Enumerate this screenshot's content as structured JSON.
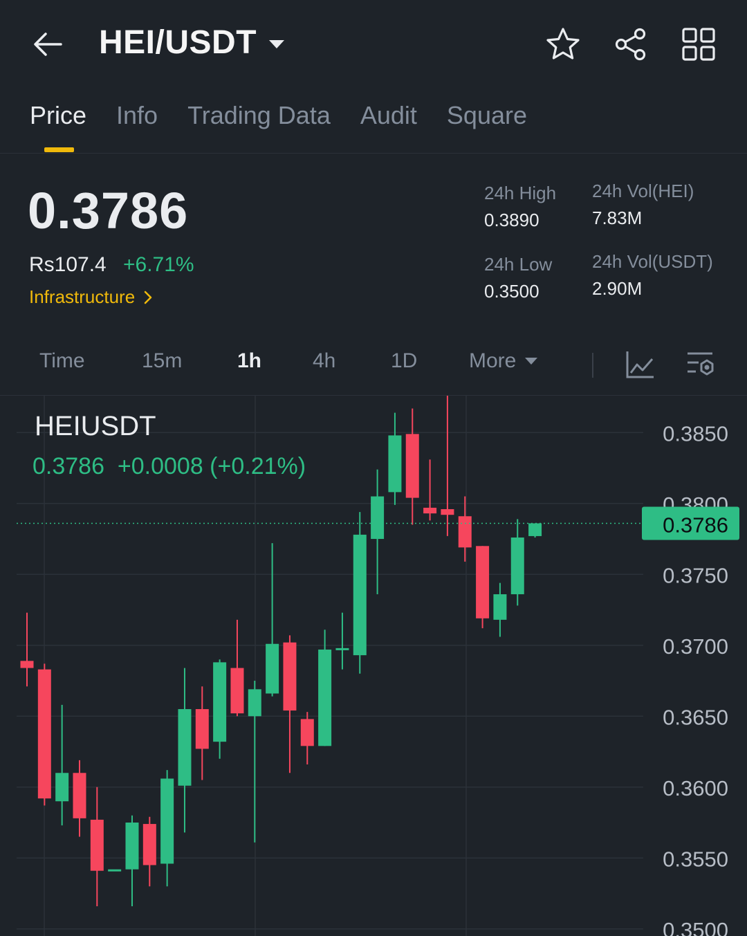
{
  "header": {
    "pair": "HEI/USDT",
    "icons": [
      "back-arrow-icon",
      "caret-down-icon",
      "star-icon",
      "share-icon",
      "grid-icon"
    ]
  },
  "tabs": [
    {
      "label": "Price",
      "active": true
    },
    {
      "label": "Info",
      "active": false
    },
    {
      "label": "Trading Data",
      "active": false
    },
    {
      "label": "Audit",
      "active": false
    },
    {
      "label": "Square",
      "active": false
    }
  ],
  "ticker": {
    "last_price": "0.3786",
    "fiat_price": "Rs107.4",
    "change_pct": "+6.71%",
    "category": "Infrastructure",
    "stats": {
      "high_label": "24h High",
      "high_value": "0.3890",
      "low_label": "24h Low",
      "low_value": "0.3500",
      "vol_base_label": "24h Vol(HEI)",
      "vol_base_value": "7.83M",
      "vol_quote_label": "24h Vol(USDT)",
      "vol_quote_value": "2.90M"
    }
  },
  "intervals": [
    {
      "label": "Time",
      "active": false
    },
    {
      "label": "15m",
      "active": false
    },
    {
      "label": "1h",
      "active": true
    },
    {
      "label": "4h",
      "active": false
    },
    {
      "label": "1D",
      "active": false
    },
    {
      "label": "More",
      "active": false
    }
  ],
  "chart_overlay": {
    "symbol": "HEIUSDT",
    "quote": "0.3786  +0.0008 (+0.21%)"
  },
  "colors": {
    "background": "#1e2329",
    "up": "#2ebd85",
    "down": "#f6465d",
    "accent": "#f0b90b",
    "muted": "#848e9c"
  },
  "chart_data": {
    "type": "candlestick",
    "ylim": [
      0.3495,
      0.3876
    ],
    "y_ticks": [
      "0.3850",
      "0.3800",
      "0.3750",
      "0.3700",
      "0.3650",
      "0.3600",
      "0.3550",
      "0.3500"
    ],
    "current_price_label": "0.3786",
    "current_price": 0.3786,
    "candles": [
      {
        "open": 0.3689,
        "close": 0.3684,
        "high": 0.3723,
        "low": 0.3671
      },
      {
        "open": 0.3683,
        "close": 0.3592,
        "high": 0.3687,
        "low": 0.3587
      },
      {
        "open": 0.359,
        "close": 0.361,
        "high": 0.3658,
        "low": 0.3573
      },
      {
        "open": 0.361,
        "close": 0.3578,
        "high": 0.3619,
        "low": 0.3565
      },
      {
        "open": 0.3577,
        "close": 0.3541,
        "high": 0.36,
        "low": 0.3516
      },
      {
        "open": 0.3542,
        "close": 0.3542,
        "high": 0.3495,
        "low": 0.3495
      },
      {
        "open": 0.3542,
        "close": 0.3575,
        "high": 0.358,
        "low": 0.3516
      },
      {
        "open": 0.3574,
        "close": 0.3545,
        "high": 0.3579,
        "low": 0.353
      },
      {
        "open": 0.3546,
        "close": 0.3606,
        "high": 0.3612,
        "low": 0.353
      },
      {
        "open": 0.3601,
        "close": 0.3655,
        "high": 0.3684,
        "low": 0.3568
      },
      {
        "open": 0.3655,
        "close": 0.3627,
        "high": 0.3671,
        "low": 0.3605
      },
      {
        "open": 0.3632,
        "close": 0.3688,
        "high": 0.369,
        "low": 0.362
      },
      {
        "open": 0.3684,
        "close": 0.3652,
        "high": 0.3718,
        "low": 0.365
      },
      {
        "open": 0.365,
        "close": 0.3669,
        "high": 0.3675,
        "low": 0.3561
      },
      {
        "open": 0.3666,
        "close": 0.3701,
        "high": 0.3772,
        "low": 0.3664
      },
      {
        "open": 0.3702,
        "close": 0.3654,
        "high": 0.3707,
        "low": 0.361
      },
      {
        "open": 0.3648,
        "close": 0.3629,
        "high": 0.3653,
        "low": 0.3616
      },
      {
        "open": 0.3629,
        "close": 0.3697,
        "high": 0.3711,
        "low": 0.3629
      },
      {
        "open": 0.3698,
        "close": 0.3698,
        "high": 0.3723,
        "low": 0.3683
      },
      {
        "open": 0.3693,
        "close": 0.3778,
        "high": 0.3794,
        "low": 0.368
      },
      {
        "open": 0.3775,
        "close": 0.3805,
        "high": 0.3824,
        "low": 0.3736
      },
      {
        "open": 0.3808,
        "close": 0.3848,
        "high": 0.3864,
        "low": 0.3799
      },
      {
        "open": 0.3849,
        "close": 0.3804,
        "high": 0.3867,
        "low": 0.3785
      },
      {
        "open": 0.3797,
        "close": 0.3793,
        "high": 0.3831,
        "low": 0.3788
      },
      {
        "open": 0.3796,
        "close": 0.3792,
        "high": 0.388,
        "low": 0.3777
      },
      {
        "open": 0.3791,
        "close": 0.3769,
        "high": 0.3805,
        "low": 0.3759
      },
      {
        "open": 0.377,
        "close": 0.3719,
        "high": 0.377,
        "low": 0.3712
      },
      {
        "open": 0.3718,
        "close": 0.3736,
        "high": 0.3744,
        "low": 0.3706
      },
      {
        "open": 0.3736,
        "close": 0.3776,
        "high": 0.3789,
        "low": 0.3728
      },
      {
        "open": 0.3777,
        "close": 0.3786,
        "high": 0.3786,
        "low": 0.3776
      }
    ]
  }
}
